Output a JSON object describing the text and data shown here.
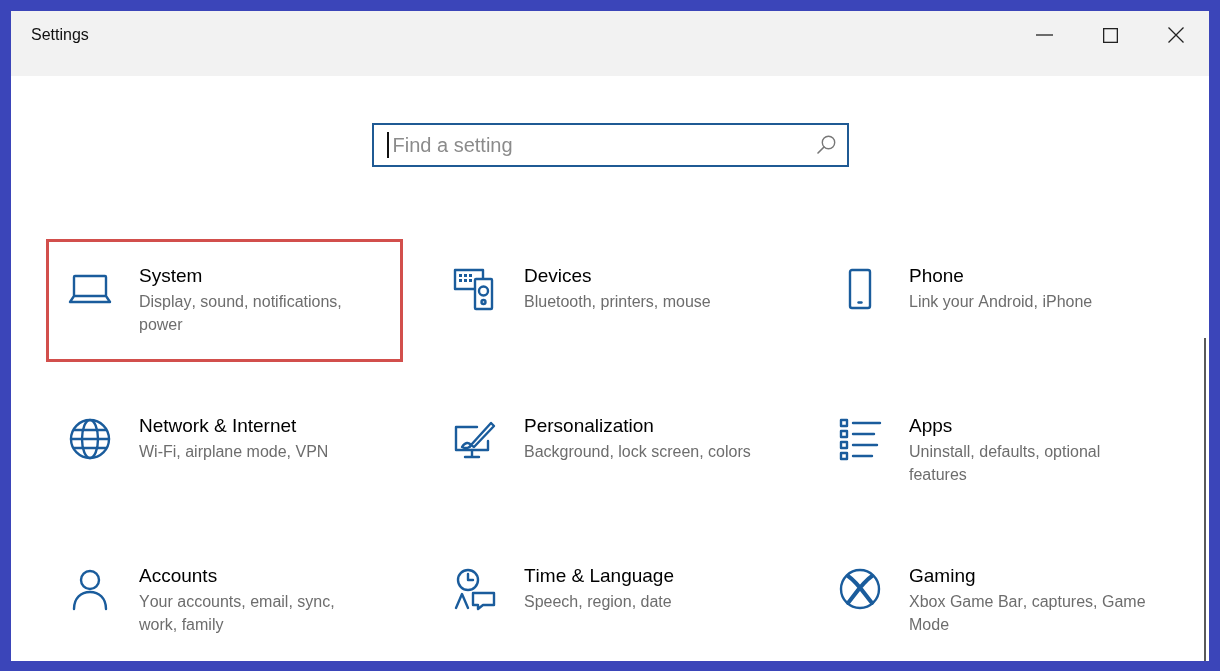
{
  "window": {
    "title": "Settings"
  },
  "search": {
    "placeholder": "Find a setting",
    "focused": true
  },
  "categories": [
    {
      "title": "System",
      "description": "Display, sound, notifications, power",
      "highlighted": true
    },
    {
      "title": "Devices",
      "description": "Bluetooth, printers, mouse",
      "highlighted": false
    },
    {
      "title": "Phone",
      "description": "Link your Android, iPhone",
      "highlighted": false
    },
    {
      "title": "Network & Internet",
      "description": "Wi-Fi, airplane mode, VPN",
      "highlighted": false
    },
    {
      "title": "Personalization",
      "description": "Background, lock screen, colors",
      "highlighted": false
    },
    {
      "title": "Apps",
      "description": "Uninstall, defaults, optional features",
      "highlighted": false
    },
    {
      "title": "Accounts",
      "description": "Your accounts, email, sync, work, family",
      "highlighted": false
    },
    {
      "title": "Time & Language",
      "description": "Speech, region, date",
      "highlighted": false
    },
    {
      "title": "Gaming",
      "description": "Xbox Game Bar, captures, Game Mode",
      "highlighted": false
    }
  ]
}
